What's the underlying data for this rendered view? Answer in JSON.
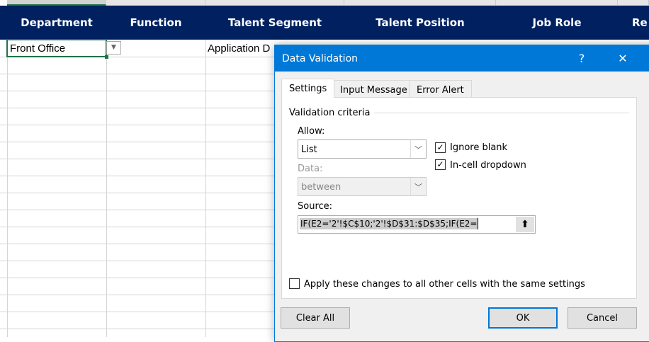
{
  "sheet": {
    "headers": [
      "Department",
      "Function",
      "Talent Segment",
      "Talent Position",
      "Job Role",
      "Re"
    ],
    "cells": {
      "a2": "Front Office",
      "c2": "Application D"
    }
  },
  "dialog": {
    "title": "Data Validation",
    "help": "?",
    "close": "✕",
    "tabs": [
      "Settings",
      "Input Message",
      "Error Alert"
    ],
    "section": "Validation criteria",
    "allow_label": "Allow:",
    "allow_value": "List",
    "data_label": "Data:",
    "data_value": "between",
    "ignore_blank": "Ignore blank",
    "ignore_blank_checked": true,
    "in_cell": "In-cell dropdown",
    "in_cell_checked": true,
    "source_label": "Source:",
    "source_value": "IF(E2='2'!$C$10;'2'!$D$31:$D$35;IF(E2=",
    "apply_all": "Apply these changes to all other cells with the same settings",
    "clear_all": "Clear All",
    "ok": "OK",
    "cancel": "Cancel"
  }
}
